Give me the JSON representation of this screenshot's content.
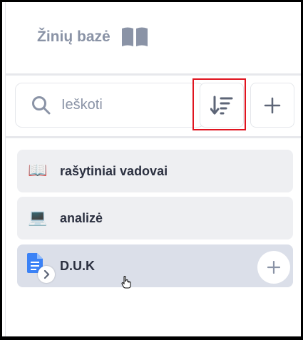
{
  "header": {
    "title": "Žinių bazė",
    "icon": "open-book-icon"
  },
  "search": {
    "placeholder": "Ieškoti",
    "icon": "search-icon"
  },
  "toolbar": {
    "sort_icon": "sort-descending-icon",
    "add_icon": "plus-icon"
  },
  "items": [
    {
      "label": "rašytiniai vadovai",
      "icon": "open-book-emoji",
      "glyph": "📖"
    },
    {
      "label": "analizė",
      "icon": "laptop-emoji",
      "glyph": "💻"
    },
    {
      "label": "D.U.K",
      "icon": "document-icon",
      "selected": true
    }
  ],
  "colors": {
    "highlight": "#e0141f",
    "item_background": "#eeeff2",
    "item_selected_background": "#dbdfe9",
    "muted_text": "#8a93a6",
    "item_text": "#2b3040",
    "document_icon": "#3b82f6"
  }
}
